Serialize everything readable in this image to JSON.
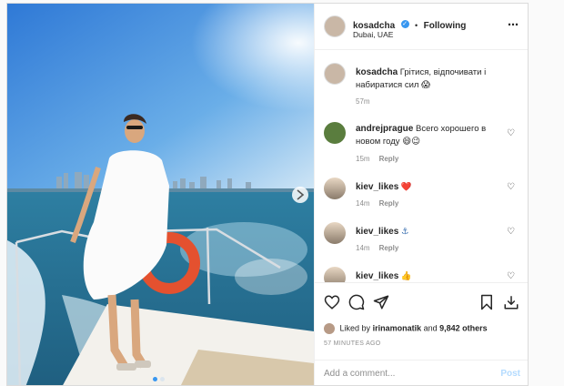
{
  "header": {
    "username": "kosadcha",
    "verified_icon": "verified-badge-icon",
    "separator": "•",
    "follow_status": "Following",
    "location": "Dubai, UAE",
    "more_icon": "more-options-icon"
  },
  "caption": {
    "username": "kosadcha",
    "text": "Грітися, відпочивати і набиратися сил 😱",
    "time": "57m"
  },
  "comments": [
    {
      "username": "andrejprague",
      "text": "Всего хорошего в новом году 😄😉",
      "time": "15m",
      "reply": "Reply"
    },
    {
      "username": "kiev_likes",
      "text": "❤️",
      "time": "14m",
      "reply": "Reply"
    },
    {
      "username": "kiev_likes",
      "text": "⚓",
      "time": "14m",
      "reply": "Reply"
    },
    {
      "username": "kiev_likes",
      "text": "👍",
      "time": "",
      "reply": ""
    }
  ],
  "likes": {
    "prefix": "Liked by",
    "user": "irinamonatik",
    "and": "and",
    "others": "9,842 others"
  },
  "posted_ago": "57 MINUTES AGO",
  "add_comment": {
    "placeholder": "Add a comment...",
    "post_label": "Post"
  },
  "colors": {
    "accent": "#3897f0",
    "heart_red": "#ed4956",
    "post_disabled": "#b3dbff"
  }
}
